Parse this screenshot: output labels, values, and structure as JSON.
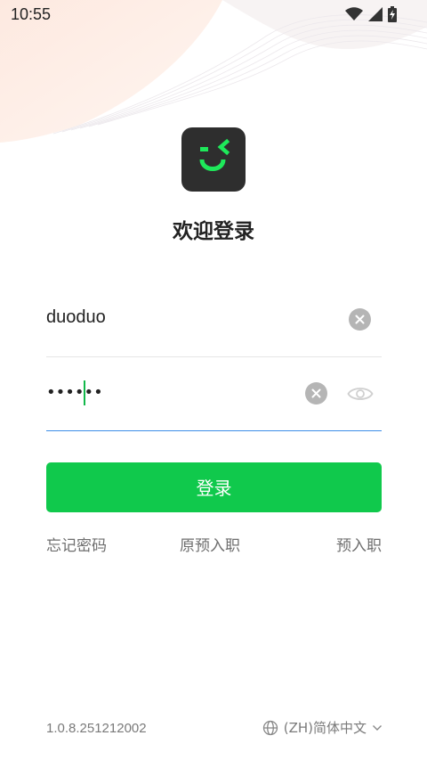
{
  "status_bar": {
    "time": "10:55",
    "icons": [
      "wifi-icon",
      "signal-icon",
      "battery-charging-icon"
    ]
  },
  "app": {
    "logo": "smile-logo-icon",
    "welcome": "欢迎登录"
  },
  "form": {
    "username_value": "duoduo",
    "password_masked": "••••••",
    "login_label": "登录"
  },
  "links": {
    "forgot_password": "忘记密码",
    "original_pre_entry": "原预入职",
    "pre_entry": "预入职"
  },
  "footer": {
    "version": "1.0.8.251212002",
    "language": "(ZH)简体中文"
  },
  "colors": {
    "accent": "#10c94c",
    "logo_bg": "#2e2e2e",
    "focus_line": "#3d8ee8"
  }
}
